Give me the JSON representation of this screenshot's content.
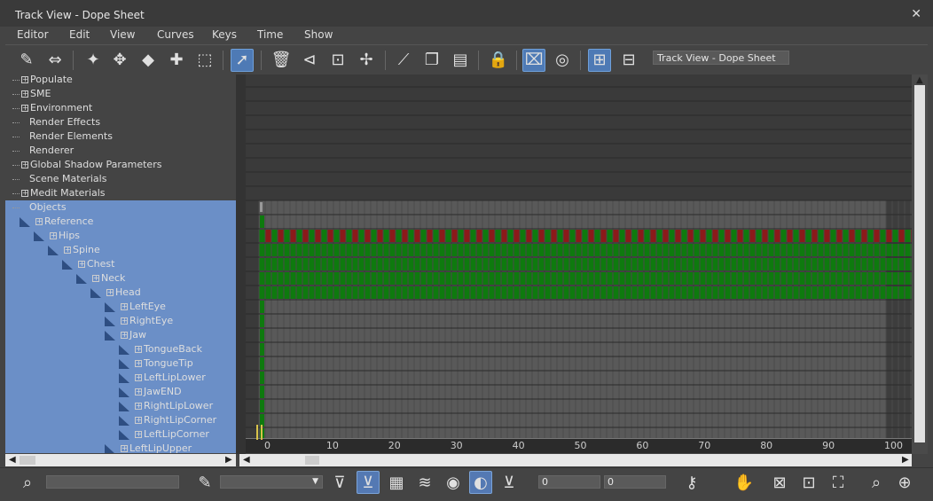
{
  "window": {
    "title": "Track View - Dope Sheet",
    "close_glyph": "✕"
  },
  "menu": [
    {
      "label": "Editor"
    },
    {
      "label": "Edit"
    },
    {
      "label": "View"
    },
    {
      "label": "Curves"
    },
    {
      "label": "Keys"
    },
    {
      "label": "Time"
    },
    {
      "label": "Show"
    }
  ],
  "toolbar": {
    "view_name": "Track View - Dope Sheet",
    "icons": [
      "filter-icon",
      "move-keys-icon",
      "slide-keys-icon",
      "add-keys-icon",
      "scale-keys-icon",
      "select-time-icon",
      "delete-time-icon",
      "reverse-time-icon",
      "scale-time-icon",
      "insert-time-icon",
      "edit-ranges-icon",
      "copy-icon",
      "paste-icon",
      "lock-selection-icon",
      "snap-frames-icon",
      "show-keyable-icon",
      "modify-subtree-icon",
      "modify-child-keys-icon"
    ],
    "active_icons": [
      "select-time-icon",
      "snap-frames-icon",
      "modify-subtree-icon"
    ]
  },
  "tree": [
    {
      "label": "Populate",
      "depth": 0,
      "expandable": true,
      "selected": false
    },
    {
      "label": "SME",
      "depth": 0,
      "expandable": true,
      "selected": false
    },
    {
      "label": "Environment",
      "depth": 0,
      "expandable": true,
      "selected": false
    },
    {
      "label": "Render Effects",
      "depth": 0,
      "expandable": false,
      "selected": false
    },
    {
      "label": "Render Elements",
      "depth": 0,
      "expandable": false,
      "selected": false
    },
    {
      "label": "Renderer",
      "depth": 0,
      "expandable": false,
      "selected": false
    },
    {
      "label": "Global Shadow Parameters",
      "depth": 0,
      "expandable": true,
      "selected": false
    },
    {
      "label": "Scene Materials",
      "depth": 0,
      "expandable": false,
      "selected": false
    },
    {
      "label": "Medit Materials",
      "depth": 0,
      "expandable": true,
      "selected": false
    },
    {
      "label": "Objects",
      "depth": 0,
      "expandable": false,
      "selected": true
    },
    {
      "label": "Reference",
      "depth": 1,
      "expandable": true,
      "selected": true
    },
    {
      "label": "Hips",
      "depth": 2,
      "expandable": true,
      "selected": true
    },
    {
      "label": "Spine",
      "depth": 3,
      "expandable": true,
      "selected": true
    },
    {
      "label": "Chest",
      "depth": 4,
      "expandable": true,
      "selected": true
    },
    {
      "label": "Neck",
      "depth": 5,
      "expandable": true,
      "selected": true
    },
    {
      "label": "Head",
      "depth": 6,
      "expandable": true,
      "selected": true
    },
    {
      "label": "LeftEye",
      "depth": 7,
      "expandable": true,
      "selected": true
    },
    {
      "label": "RightEye",
      "depth": 7,
      "expandable": true,
      "selected": true
    },
    {
      "label": "Jaw",
      "depth": 7,
      "expandable": true,
      "selected": true
    },
    {
      "label": "TongueBack",
      "depth": 8,
      "expandable": true,
      "selected": true
    },
    {
      "label": "TongueTip",
      "depth": 8,
      "expandable": true,
      "selected": true
    },
    {
      "label": "LeftLipLower",
      "depth": 8,
      "expandable": true,
      "selected": true
    },
    {
      "label": "JawEND",
      "depth": 8,
      "expandable": true,
      "selected": true
    },
    {
      "label": "RightLipLower",
      "depth": 8,
      "expandable": true,
      "selected": true
    },
    {
      "label": "RightLipCorner",
      "depth": 8,
      "expandable": true,
      "selected": true
    },
    {
      "label": "LeftLipCorner",
      "depth": 8,
      "expandable": true,
      "selected": true
    },
    {
      "label": "LeftLipUpper",
      "depth": 7,
      "expandable": true,
      "selected": true
    }
  ],
  "dope": {
    "frame_start": 0,
    "frame_end": 100,
    "visible_end": 107,
    "key_rows": [
      {
        "row": 10,
        "kind": "start"
      },
      {
        "row": 11,
        "kind": "alt"
      },
      {
        "row": 12,
        "kind": "full"
      },
      {
        "row": 13,
        "kind": "full"
      },
      {
        "row": 14,
        "kind": "full"
      },
      {
        "row": 15,
        "kind": "full"
      }
    ],
    "colors": {
      "key": "#0e7a0e",
      "key_alt": "#8b1a1a",
      "bg_range": "#595959",
      "bg_out": "#3d3d3d",
      "top_bg": "#3a3a3a"
    }
  },
  "ruler": {
    "ticks": [
      {
        "label": "0"
      },
      {
        "label": "10"
      },
      {
        "label": "20"
      },
      {
        "label": "30"
      },
      {
        "label": "40"
      },
      {
        "label": "50"
      },
      {
        "label": "60"
      },
      {
        "label": "70"
      },
      {
        "label": "80"
      },
      {
        "label": "90"
      },
      {
        "label": "100"
      }
    ]
  },
  "bottom": {
    "search_value": "",
    "filter_value": "",
    "frame_a": "0",
    "frame_b": "0",
    "icons": [
      "zoom-selected-icon",
      "rename-icon",
      "filter-selected-icon",
      "filter-selected-on-icon",
      "show-all-icon",
      "layer-icon",
      "keyable-icon",
      "visible-icon",
      "lock-icon",
      "key-info-icon",
      "pan-icon",
      "frame-horizontal-icon",
      "frame-value-icon",
      "zoom-region-icon",
      "zoom-icon",
      "zoom-region-selection-icon"
    ],
    "active_icons": [
      "filter-selected-on-icon",
      "visible-icon"
    ]
  }
}
